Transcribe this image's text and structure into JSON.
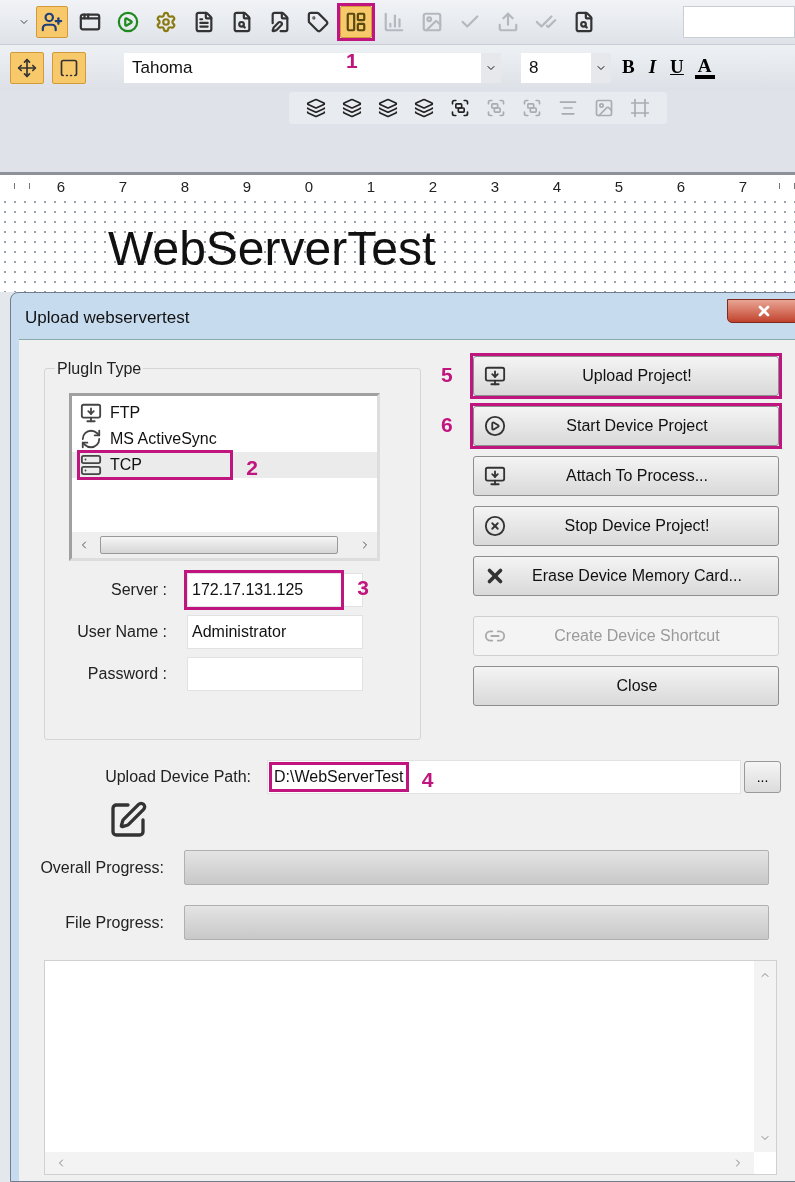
{
  "toolbar_1": {
    "buttons": [
      {
        "kind": "caret",
        "disabled": false
      },
      {
        "kind": "user-add",
        "active": true,
        "disabled": false
      },
      {
        "kind": "window",
        "active": false,
        "disabled": false
      },
      {
        "kind": "play",
        "active": false,
        "disabled": false
      },
      {
        "kind": "gear",
        "active": false,
        "disabled": false
      },
      {
        "kind": "document",
        "active": false,
        "disabled": false
      },
      {
        "kind": "search-document",
        "active": false,
        "disabled": false
      },
      {
        "kind": "check-document",
        "active": false,
        "disabled": false
      },
      {
        "kind": "tag",
        "active": false,
        "disabled": false
      },
      {
        "kind": "panel",
        "active": true,
        "disabled": false,
        "callout": {
          "label": "1"
        }
      },
      {
        "kind": "chart",
        "active": false,
        "disabled": true
      },
      {
        "kind": "image",
        "active": false,
        "disabled": true
      },
      {
        "kind": "checkmark",
        "active": false,
        "disabled": true
      },
      {
        "kind": "upload",
        "active": false,
        "disabled": true
      },
      {
        "kind": "double-check",
        "active": false,
        "disabled": true
      },
      {
        "kind": "search-document",
        "active": false,
        "disabled": false
      }
    ]
  },
  "toolbar_2": {
    "buttons": [
      {
        "kind": "move",
        "active": true
      },
      {
        "kind": "corner",
        "active": true
      }
    ],
    "font": "Tahoma",
    "size": "8",
    "format_buttons": [
      {
        "label": "B",
        "kind": "bold"
      },
      {
        "label": "I",
        "kind": "italic"
      },
      {
        "label": "U",
        "kind": "underline"
      },
      {
        "label": "A",
        "kind": "color"
      }
    ]
  },
  "toolbar_3": {
    "buttons": [
      {
        "kind": "layers",
        "disabled": false
      },
      {
        "kind": "layers",
        "disabled": false
      },
      {
        "kind": "layers",
        "disabled": false
      },
      {
        "kind": "layers",
        "disabled": false
      },
      {
        "kind": "group",
        "disabled": false
      },
      {
        "kind": "group",
        "disabled": true
      },
      {
        "kind": "group",
        "disabled": true
      },
      {
        "kind": "align",
        "disabled": true
      },
      {
        "kind": "image",
        "disabled": true
      },
      {
        "kind": "frame",
        "disabled": true
      }
    ]
  },
  "ruler": [
    "6",
    "7",
    "8",
    "9",
    "0",
    "1",
    "2",
    "3",
    "4",
    "5",
    "6",
    "7"
  ],
  "canvas": {
    "title": "WebServerTest"
  },
  "dialog": {
    "title": "Upload webservertest",
    "plugin_group": {
      "title": "PlugIn Type",
      "items": [
        {
          "label": "FTP",
          "kind": "ftp",
          "selected": false
        },
        {
          "label": "MS ActiveSync",
          "kind": "sync",
          "selected": false
        },
        {
          "label": "TCP",
          "kind": "tcp",
          "selected": true,
          "callout": {
            "label": "2"
          }
        }
      ]
    },
    "fields": [
      {
        "label": "Server :",
        "value": "172.17.131.125",
        "callout": {
          "label": "3"
        }
      },
      {
        "label": "User Name :",
        "value": "Administrator"
      },
      {
        "label": "Password :"
      }
    ],
    "buttons": [
      {
        "label": "Upload Project!",
        "kind": "upload",
        "disabled": false,
        "callout": {
          "label": "5"
        }
      },
      {
        "label": "Start Device Project",
        "kind": "start",
        "disabled": false,
        "callout": {
          "label": "6"
        }
      },
      {
        "label": "Attach To Process...",
        "kind": "upload",
        "disabled": false
      },
      {
        "label": "Stop Device Project!",
        "kind": "stop",
        "disabled": false
      },
      {
        "label": "Erase Device Memory Card...",
        "kind": "erase",
        "disabled": false
      },
      {
        "label": "Create Device Shortcut",
        "kind": "shortcut",
        "disabled": true
      },
      {
        "label": "Close",
        "kind": "plain",
        "disabled": false
      }
    ],
    "path": {
      "label": "Upload Device Path:",
      "value": "D:\\WebServerTest",
      "browse": "...",
      "callout": {
        "label": "4"
      }
    },
    "progress": [
      {
        "label": "Overall Progress:",
        "level": 0
      },
      {
        "label": "File Progress:",
        "level": 0
      }
    ]
  }
}
